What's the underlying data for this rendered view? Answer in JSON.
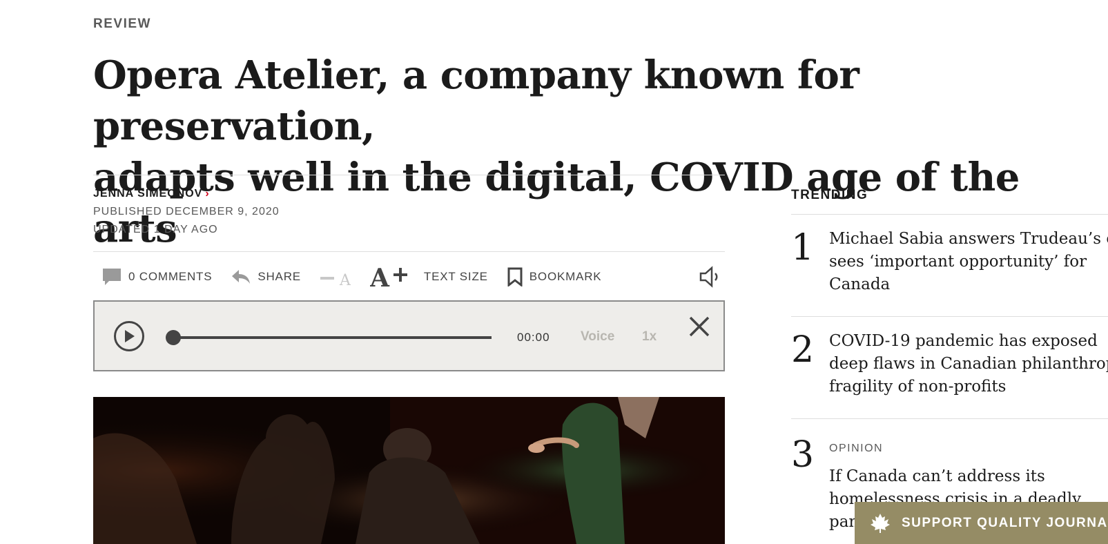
{
  "article": {
    "kicker": "REVIEW",
    "headline_line1": "Opera Atelier, a company known for preservation,",
    "headline_line2": "adapts well in the digital, COVID age of the arts",
    "author": "JENNA SIMEONOV",
    "published": "PUBLISHED DECEMBER 9, 2020",
    "updated": "UPDATED 1 DAY AGO"
  },
  "toolbar": {
    "comments_label": "0 COMMENTS",
    "share_label": "SHARE",
    "text_size_label": "TEXT SIZE",
    "bookmark_label": "BOOKMARK"
  },
  "audio_player": {
    "time": "00:00",
    "voice_label": "Voice",
    "rate_label": "1x",
    "progress": 0
  },
  "trending": {
    "label": "TRENDING",
    "items": [
      {
        "number": "1",
        "kicker": "",
        "lines": [
          "Michael Sabia answers Trudeau’s call,",
          "sees ‘important opportunity’ for",
          "Canada"
        ]
      },
      {
        "number": "2",
        "kicker": "",
        "lines": [
          "COVID-19 pandemic has exposed",
          "deep flaws in Canadian philanthropy,",
          "fragility of non-profits"
        ]
      },
      {
        "number": "3",
        "kicker": "OPINION",
        "lines": [
          "If Canada can’t address its",
          "homelessness crisis in a deadly",
          "pandemic"
        ]
      }
    ]
  },
  "support_banner": {
    "label": "SUPPORT QUALITY JOURNALISM"
  },
  "colors": {
    "accent_red": "#d0021b",
    "banner_gold": "#958c65",
    "player_bg": "#eeedea"
  }
}
